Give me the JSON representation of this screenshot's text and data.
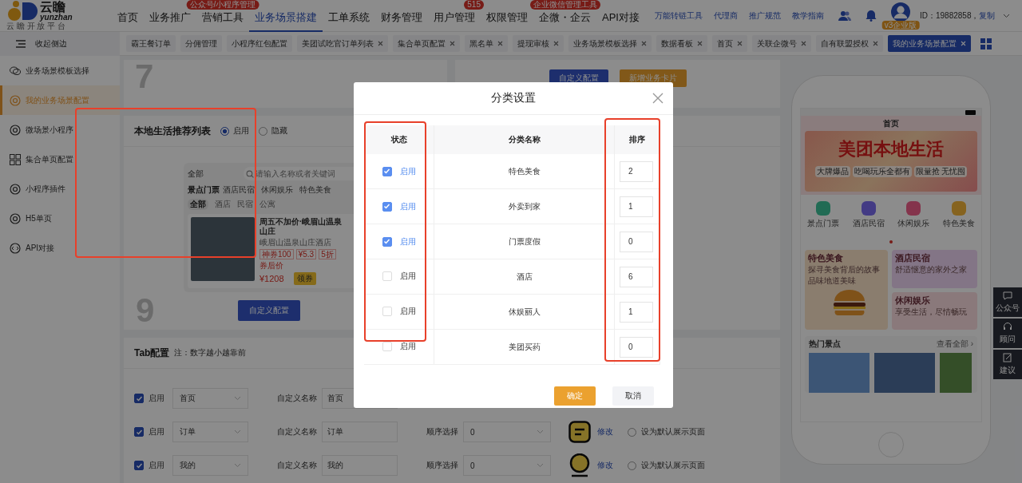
{
  "header": {
    "logo": {
      "name": "云瞻",
      "latin": "yunzhan",
      "slogan": "云 瞻 开 放 平 台"
    },
    "nav": [
      {
        "label": "首页",
        "selected": false
      },
      {
        "label": "业务推广",
        "selected": false
      },
      {
        "label": "营销工具",
        "selected": false,
        "badge": "公众号/小程序管理"
      },
      {
        "label": "业务场景搭建",
        "selected": true
      },
      {
        "label": "工单系统",
        "selected": false
      },
      {
        "label": "财务管理",
        "selected": false
      },
      {
        "label": "用户管理",
        "selected": false,
        "badge": "515"
      },
      {
        "label": "权限管理",
        "selected": false
      },
      {
        "label": "企微・企云",
        "selected": false,
        "badge": "企业微信管理工具"
      },
      {
        "label": "API对接",
        "selected": false
      }
    ],
    "links": [
      "万能转链工具",
      "代理商",
      "推广规范",
      "教学指南"
    ],
    "user": {
      "plan": "v3企业版",
      "id": "ID：19882858，",
      "copy": "复制"
    }
  },
  "sidebar": {
    "collapse": "收起侧边",
    "items": [
      {
        "label": "业务场景模板选择",
        "kind": "chat",
        "selected": false
      },
      {
        "label": "我的业务场景配置",
        "kind": "ring",
        "selected": true
      },
      {
        "label": "微场景小程序",
        "kind": "ring",
        "selected": false
      },
      {
        "label": "集合单页配置",
        "kind": "grid",
        "selected": false
      },
      {
        "label": "小程序插件",
        "kind": "ring",
        "selected": false
      },
      {
        "label": "H5单页",
        "kind": "ring",
        "selected": false
      },
      {
        "label": "API对接",
        "kind": "code",
        "selected": false
      }
    ]
  },
  "tabs": [
    {
      "label": "霸王餐订单",
      "closable": false,
      "selected": false
    },
    {
      "label": "分佣管理",
      "closable": false,
      "selected": false
    },
    {
      "label": "小程序红包配置",
      "closable": false,
      "selected": false
    },
    {
      "label": "美团试吃官订单列表",
      "closable": true,
      "selected": false
    },
    {
      "label": "集合单页配置",
      "closable": true,
      "selected": false
    },
    {
      "label": "黑名单",
      "closable": true,
      "selected": false
    },
    {
      "label": "提现审核",
      "closable": true,
      "selected": false
    },
    {
      "label": "业务场景模板选择",
      "closable": true,
      "selected": false
    },
    {
      "label": "数据看板",
      "closable": true,
      "selected": false
    },
    {
      "label": "首页",
      "closable": true,
      "selected": false
    },
    {
      "label": "关联企微号",
      "closable": true,
      "selected": false
    },
    {
      "label": "自有联盟授权",
      "closable": true,
      "selected": false
    },
    {
      "label": "我的业务场景配置",
      "closable": true,
      "selected": true
    }
  ],
  "card_7": {
    "number": "7"
  },
  "card_8": {
    "buttons": [
      "自定义配置",
      "新增业务卡片"
    ]
  },
  "local_list": {
    "title": "本地生活推荐列表",
    "options": [
      {
        "label": "启用",
        "selected": true
      },
      {
        "label": "隐藏",
        "selected": false
      }
    ],
    "preview": {
      "filter": "全部",
      "placeholder": "请输入名称或者关键词",
      "categories": [
        {
          "label": "景点门票",
          "selected": true
        },
        {
          "label": "酒店民宿",
          "selected": false
        },
        {
          "label": "休闲娱乐",
          "selected": false
        },
        {
          "label": "特色美食",
          "selected": false
        }
      ],
      "subcategories": [
        {
          "label": "全部",
          "selected": true
        },
        {
          "label": "酒店",
          "selected": false
        },
        {
          "label": "民宿",
          "selected": false
        },
        {
          "label": "公寓",
          "selected": false
        }
      ],
      "item": {
        "title": "周五不加价·峨眉山温泉山庄",
        "hotel": "峨眉山温泉山庄酒店",
        "tags": [
          "神券100",
          "¥5.3",
          "5折"
        ],
        "price_label": "券后价",
        "price": "¥1208",
        "action": "领券"
      }
    },
    "number": "9",
    "button": "自定义配置"
  },
  "tab_config": {
    "title": "Tab配置",
    "note": "注：数字越小越靠前",
    "rows": [
      {
        "enabled": true,
        "enabled_label": "启用",
        "page": "首页",
        "name_label": "自定义名称",
        "name": "首页"
      },
      {
        "enabled": true,
        "enabled_label": "启用",
        "page": "订单",
        "name_label": "自定义名称",
        "name": "订单",
        "order_label": "顺序选择",
        "order": "0",
        "kind": "square",
        "edit": "修改",
        "default_label": "设为默认展示页面",
        "default": false
      },
      {
        "enabled": true,
        "enabled_label": "启用",
        "page": "我的",
        "name_label": "自定义名称",
        "name": "我的",
        "order_label": "顺序选择",
        "order": "0",
        "kind": "circle",
        "edit": "修改",
        "default_label": "设为默认展示页面",
        "default": false
      }
    ]
  },
  "phone": {
    "title": "首页",
    "banner": {
      "title": "美团本地生活",
      "chips": [
        "大牌爆品",
        "吃喝玩乐全都有",
        "限量抢 无忧囤"
      ]
    },
    "shortcuts": [
      "景点门票",
      "酒店民宿",
      "休闲娱乐",
      "特色美食"
    ],
    "cards": [
      {
        "title": "特色美食",
        "lines": [
          "探寻美食背后的故事",
          "品味地道美味"
        ]
      },
      {
        "title": "酒店民宿",
        "lines": [
          "舒适惬意的家外之家"
        ]
      },
      {
        "title": "休闲娱乐",
        "lines": [
          "享受生活，尽情畅玩"
        ]
      }
    ],
    "hot": {
      "title": "热门景点",
      "more": "查看全部 ›"
    }
  },
  "float_buttons": [
    {
      "label": "公众号",
      "kind": "chat"
    },
    {
      "label": "顾问",
      "kind": "headset"
    },
    {
      "label": "建议",
      "kind": "edit"
    }
  ],
  "dialog": {
    "title": "分类设置",
    "columns": [
      "状态",
      "分类名称",
      "排序"
    ],
    "rows": [
      {
        "enabled": true,
        "label": "启用",
        "name": "特色美食",
        "order": "2"
      },
      {
        "enabled": true,
        "label": "启用",
        "name": "外卖到家",
        "order": "1"
      },
      {
        "enabled": true,
        "label": "启用",
        "name": "门票度假",
        "order": "0"
      },
      {
        "enabled": false,
        "label": "启用",
        "name": "酒店",
        "order": "6"
      },
      {
        "enabled": false,
        "label": "启用",
        "name": "休娱丽人",
        "order": "1"
      },
      {
        "enabled": false,
        "label": "启用",
        "name": "美团买药",
        "order": "0"
      }
    ],
    "confirm": "确定",
    "cancel": "取消"
  }
}
